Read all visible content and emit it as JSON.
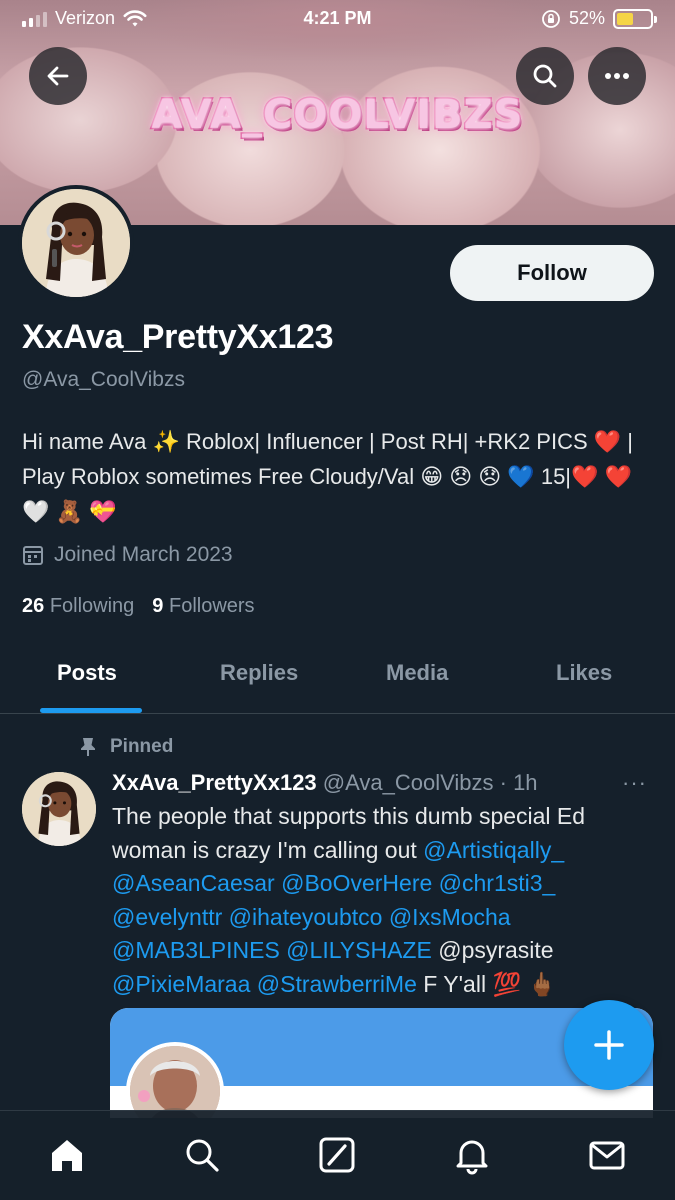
{
  "status_bar": {
    "carrier": "Verizon",
    "time": "4:21 PM",
    "battery": "52%"
  },
  "banner": {
    "title": "AVA_COOLVIBZS"
  },
  "profile": {
    "follow_label": "Follow",
    "display_name": "XxAva_PrettyXx123",
    "handle": "@Ava_CoolVibzs",
    "bio": "Hi name Ava ✨ Roblox| Influencer | Post RH| +RK2 PICS ❤️ | Play Roblox sometimes Free Cloudy/Val 😁 😞 😞 💙 15|❤️ ❤️ 🤍 🧸 💝",
    "joined": "Joined March 2023",
    "following_count": "26",
    "following_label": "Following",
    "followers_count": "9",
    "followers_label": "Followers"
  },
  "tabs": [
    {
      "label": "Posts"
    },
    {
      "label": "Replies"
    },
    {
      "label": "Media"
    },
    {
      "label": "Likes"
    }
  ],
  "tweet": {
    "pinned_label": "Pinned",
    "author_name": "XxAva_PrettyXx123",
    "author_handle_time": "@Ava_CoolVibzs · 1h",
    "more": "···",
    "text_before": "The people that supports this dumb special Ed woman is crazy I'm calling out ",
    "mentions_1": "@Artistiqally_ @AseanCaesar @BoOverHere @chr1sti3_ @evelynttr @ihateyoubtco @IxsMocha @MAB3LPINES @LILYSHAZE",
    "plain_mention": " @psyrasite ",
    "mentions_2": "@PixieMaraa  @StrawberriMe",
    "text_after": " F Y'all 💯 🖕🏾"
  },
  "icons": {
    "back": "arrow-left-icon",
    "search": "search-icon",
    "more": "more-horizontal-icon",
    "calendar": "calendar-icon",
    "pin": "pin-icon",
    "compose": "plus-icon",
    "nav": [
      "home-icon",
      "search-icon",
      "grok-icon",
      "bell-icon",
      "mail-icon"
    ]
  },
  "colors": {
    "background": "#15202b",
    "accent": "#1d9bf0",
    "muted_text": "#8b98a5"
  }
}
